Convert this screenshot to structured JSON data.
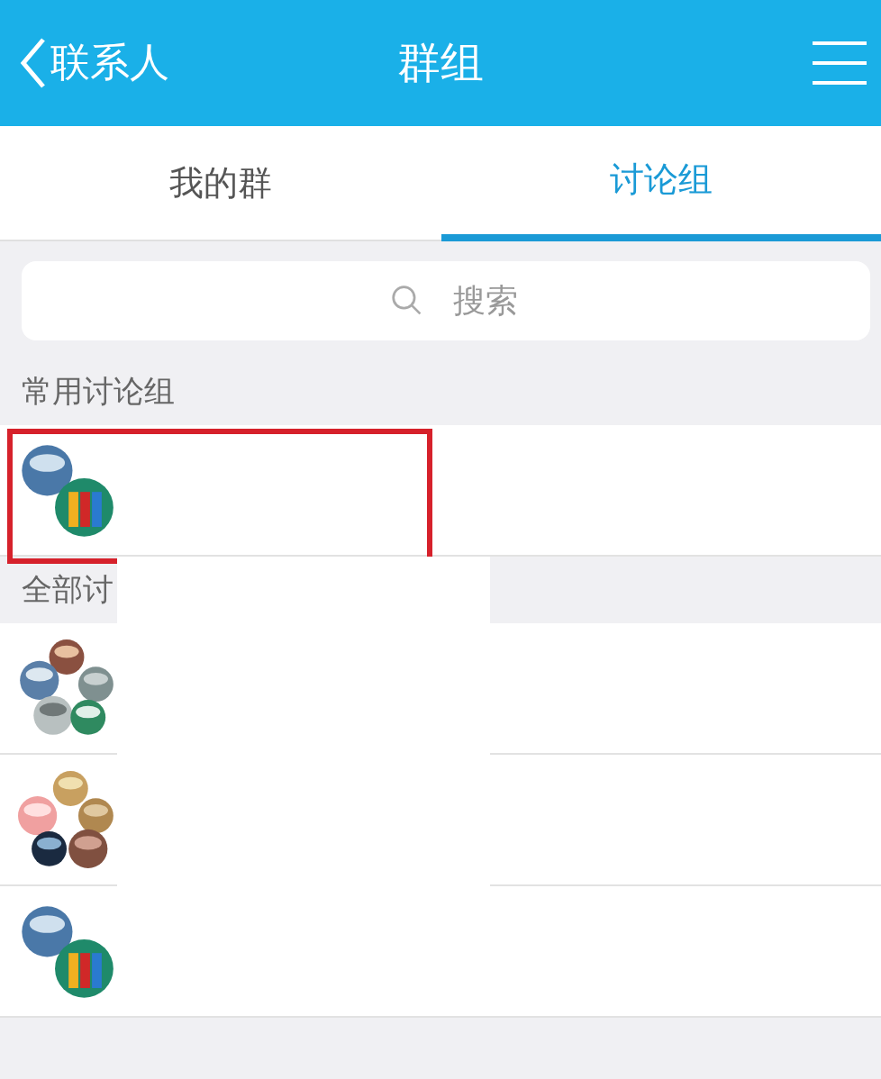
{
  "nav_bar": {
    "back_label": "联系人",
    "title": "群组"
  },
  "tabs": [
    {
      "label": "我的群",
      "selected": false
    },
    {
      "label": "讨论组",
      "selected": true
    }
  ],
  "search": {
    "placeholder": "搜索"
  },
  "sections": [
    {
      "title": "常用讨论组",
      "groups": [
        {
          "kind": "pair",
          "highlighted": true
        }
      ]
    },
    {
      "title": "全部讨",
      "groups": [
        {
          "kind": "five-a",
          "highlighted": false
        },
        {
          "kind": "five-b",
          "highlighted": false
        },
        {
          "kind": "pair",
          "highlighted": false
        }
      ]
    }
  ]
}
